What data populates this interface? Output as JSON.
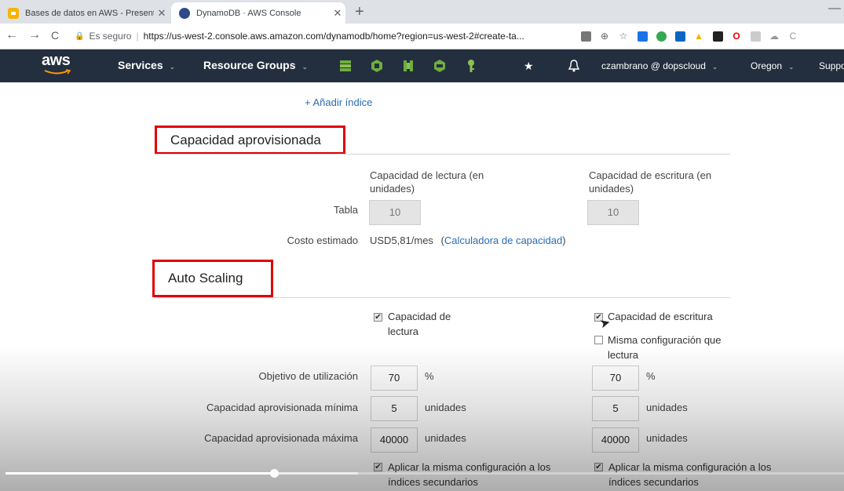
{
  "browser": {
    "tabs": [
      {
        "title": "Bases de datos en AWS - Present",
        "active": false,
        "icon": "slides-icon"
      },
      {
        "title": "DynamoDB · AWS Console",
        "active": true,
        "icon": "dynamodb-icon"
      }
    ],
    "close_glyph": "✕",
    "new_tab_glyph": "+",
    "minimize_glyph": "—",
    "back_glyph": "←",
    "forward_glyph": "→",
    "reload_glyph": "C",
    "secure_label": "Es seguro",
    "url": "https://us-west-2.console.aws.amazon.com/dynamodb/home?region=us-west-2#create-ta..."
  },
  "aws_nav": {
    "logo_text": "aws",
    "services_label": "Services",
    "resource_groups_label": "Resource Groups",
    "account_label": "czambrano @ dopscloud",
    "region_label": "Oregon",
    "support_label": "Suppo",
    "caret": "⌄"
  },
  "page": {
    "add_index_label": "+ Añadir índice",
    "provisioned": {
      "title": "Capacidad aprovisionada",
      "read_header": "Capacidad de lectura (en unidades)",
      "write_header": "Capacidad de escritura (en unidades)",
      "table_label": "Tabla",
      "read_value": "10",
      "write_value": "10",
      "cost_label": "Costo estimado",
      "cost_value": "USD5,81/mes",
      "calc_open": "(",
      "calc_link": "Calculadora de capacidad",
      "calc_close": ")"
    },
    "autoscaling": {
      "title": "Auto Scaling",
      "read_checkbox_label": "Capacidad de lectura",
      "write_checkbox_label": "Capacidad de escritura",
      "same_config_label": "Misma configuración que lectura",
      "target_label": "Objetivo de utilización",
      "min_label": "Capacidad aprovisionada mínima",
      "max_label": "Capacidad aprovisionada máxima",
      "read": {
        "target": "70",
        "min": "5",
        "max": "40000"
      },
      "write": {
        "target": "70",
        "min": "5",
        "max": "40000"
      },
      "percent_unit": "%",
      "units_label": "unidades",
      "apply_secondary_label": "Aplicar la misma configuración a los índices secundarios",
      "checks": {
        "read": true,
        "write": true,
        "same_config": false,
        "apply_read": true,
        "apply_write": true
      }
    }
  },
  "video": {
    "played_fraction": 0.32,
    "buffered_fraction": 0.42
  },
  "colors": {
    "aws_nav_bg": "#232f3e",
    "highlight_border": "#e00000",
    "link": "#2b6cb0"
  }
}
